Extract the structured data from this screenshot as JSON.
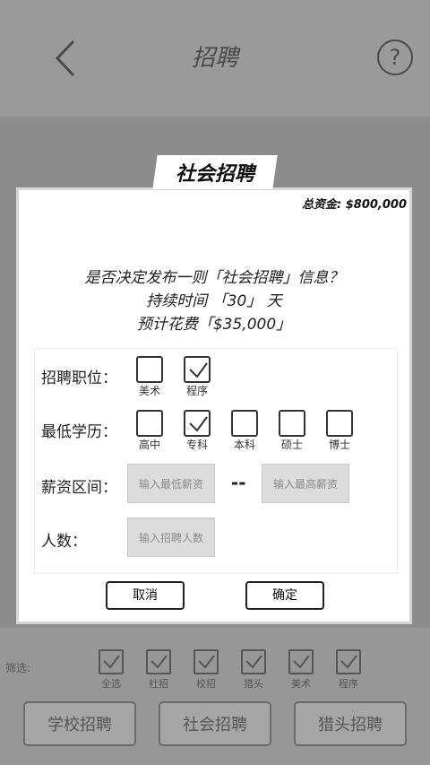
{
  "header": {
    "title": "招聘",
    "help_glyph": "?"
  },
  "dialog": {
    "title": "社会招聘",
    "funds": "总资金: $800,000",
    "question_lines": [
      "是否决定发布一则「社会招聘」信息？",
      "持续时间 「30」 天",
      "预计花费「$35,000」"
    ],
    "position": {
      "label": "招聘职位：",
      "options": [
        {
          "label": "美术",
          "checked": false
        },
        {
          "label": "程序",
          "checked": true
        }
      ]
    },
    "education": {
      "label": "最低学历：",
      "options": [
        {
          "label": "高中",
          "checked": false
        },
        {
          "label": "专科",
          "checked": true
        },
        {
          "label": "本科",
          "checked": false
        },
        {
          "label": "硕士",
          "checked": false
        },
        {
          "label": "博士",
          "checked": false
        }
      ]
    },
    "salary": {
      "label": "薪资区间：",
      "min_placeholder": "输入最低薪资",
      "separator": "--",
      "max_placeholder": "输入最高薪资"
    },
    "count": {
      "label": "人数：",
      "placeholder": "输入招聘人数"
    },
    "cancel_label": "取消",
    "confirm_label": "确定"
  },
  "filter": {
    "label": "筛选:",
    "items": [
      {
        "label": "全选",
        "checked": true
      },
      {
        "label": "社招",
        "checked": true
      },
      {
        "label": "校招",
        "checked": true
      },
      {
        "label": "猎头",
        "checked": true
      },
      {
        "label": "美术",
        "checked": true
      },
      {
        "label": "程序",
        "checked": true
      }
    ]
  },
  "tabs": [
    {
      "label": "学校招聘"
    },
    {
      "label": "社会招聘"
    },
    {
      "label": "猎头招聘"
    }
  ]
}
